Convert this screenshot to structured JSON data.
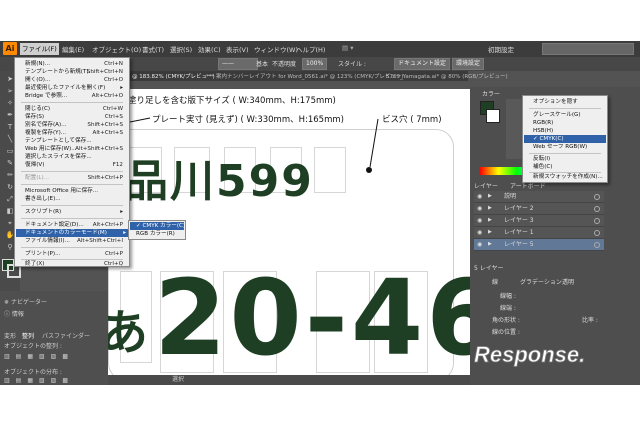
{
  "app": {
    "logo": "Ai",
    "menus": [
      "ファイル(F)",
      "編集(E)",
      "オブジェクト(O)",
      "書式(T)",
      "選択(S)",
      "効果(C)",
      "表示(V)",
      "ウィンドウ(W)",
      "ヘルプ(H)"
    ],
    "workspace": "初期設定",
    "control": {
      "stroke_style": "基本",
      "opacity": "100%",
      "opacity_label": "不透明度",
      "style_label": "スタイル :",
      "doc_settings": "ドキュメント設定",
      "env_settings": "環境設定"
    },
    "tabs": [
      "@ 183.82% (CMYK/プレビュー)",
      "*** 案内ナンバーレイアウト for Word_0561.ai* @ 123% (CMYK/プレビュー)",
      "5769_Yamagata.ai* @ 80% (RGB/プレビュー)"
    ]
  },
  "file_menu": {
    "items": [
      {
        "label": "新規(N)...",
        "shortcut": "Ctrl+N"
      },
      {
        "label": "テンプレートから新規(T)...",
        "shortcut": "Shift+Ctrl+N"
      },
      {
        "label": "開く(O)...",
        "shortcut": "Ctrl+O"
      },
      {
        "label": "最近使用したファイルを開く(F)",
        "shortcut": "▸"
      },
      {
        "label": "Bridge で参照...",
        "shortcut": "Alt+Ctrl+O"
      },
      {
        "label": "閉じる(C)",
        "shortcut": "Ctrl+W"
      },
      {
        "label": "保存(S)",
        "shortcut": "Ctrl+S"
      },
      {
        "label": "別名で保存(A)...",
        "shortcut": "Shift+Ctrl+S"
      },
      {
        "label": "複製を保存(Y)...",
        "shortcut": "Alt+Ctrl+S"
      },
      {
        "label": "テンプレートとして保存...",
        "shortcut": ""
      },
      {
        "label": "Web 用に保存(W)...",
        "shortcut": "Alt+Shift+Ctrl+S"
      },
      {
        "label": "選択したスライスを保存...",
        "shortcut": ""
      },
      {
        "label": "復帰(V)",
        "shortcut": "F12"
      },
      {
        "label": "配置(L)...",
        "shortcut": "Shift+Ctrl+P"
      },
      {
        "label": "Microsoft Office 用に保存...",
        "shortcut": ""
      },
      {
        "label": "書き出し(E)...",
        "shortcut": ""
      },
      {
        "label": "スクリプト(R)",
        "shortcut": "▸"
      },
      {
        "label": "ドキュメント設定(D)...",
        "shortcut": "Alt+Ctrl+P"
      },
      {
        "label": "ドキュメントのカラーモード(M)",
        "shortcut": "▸"
      },
      {
        "label": "ファイル情報(I)...",
        "shortcut": "Alt+Shift+Ctrl+I"
      },
      {
        "label": "プリント(P)...",
        "shortcut": "Ctrl+P"
      },
      {
        "label": "終了(X)",
        "shortcut": "Ctrl+Q"
      }
    ]
  },
  "color_mode_submenu": [
    "✓ CMYK カラー(C)",
    "RGB カラー(R)"
  ],
  "color_panel_menu": {
    "items": [
      "オプションを隠す",
      "グレースケール(G)",
      "RGB(R)",
      "HSB(H)",
      "✓ CMYK(C)",
      "Web セーフ RGB(W)",
      "反転(I)",
      "補色(C)",
      "新規スウォッチを作成(N)..."
    ]
  },
  "canvas": {
    "label_bleed": "塗り足しを含む版下サイズ ( W:340mm、H:175mm)",
    "label_plate": "プレート実寸 (見えず) ( W:330mm、H:165mm)",
    "label_hole": "ビス穴 ( 7mm)",
    "plate_top_text": "品川599",
    "plate_bottom_kana": "あ",
    "plate_bottom_text": "20-46",
    "plate_color": "#1e3f23"
  },
  "left_panel": {
    "navigator": "ナビゲーター",
    "info": "情報",
    "tabs": [
      "変形",
      "整列",
      "パスファインダー"
    ],
    "align_objects": "オブジェクトの整列 :",
    "distribute_objects": "オブジェクトの分布 :"
  },
  "status": {
    "label": "選択"
  },
  "right_panel": {
    "color_tab": "カラー",
    "layers_tab": "レイヤー",
    "artboards_tab": "アートボード",
    "layers": [
      "説明",
      "レイヤー 2",
      "レイヤー 3",
      "レイヤー 1",
      "レイヤー 5"
    ],
    "layer_count": "5 レイヤー",
    "gradient_tab": "グラデーション",
    "transparency_tab": "透明",
    "stroke_label": "線幅 :",
    "stroke_tab": "線",
    "weight_label": "線端 :",
    "corner_label": "角の形状 :",
    "align_label": "線の位置 :",
    "ratio_label": "比率 :"
  },
  "watermark": "Response."
}
